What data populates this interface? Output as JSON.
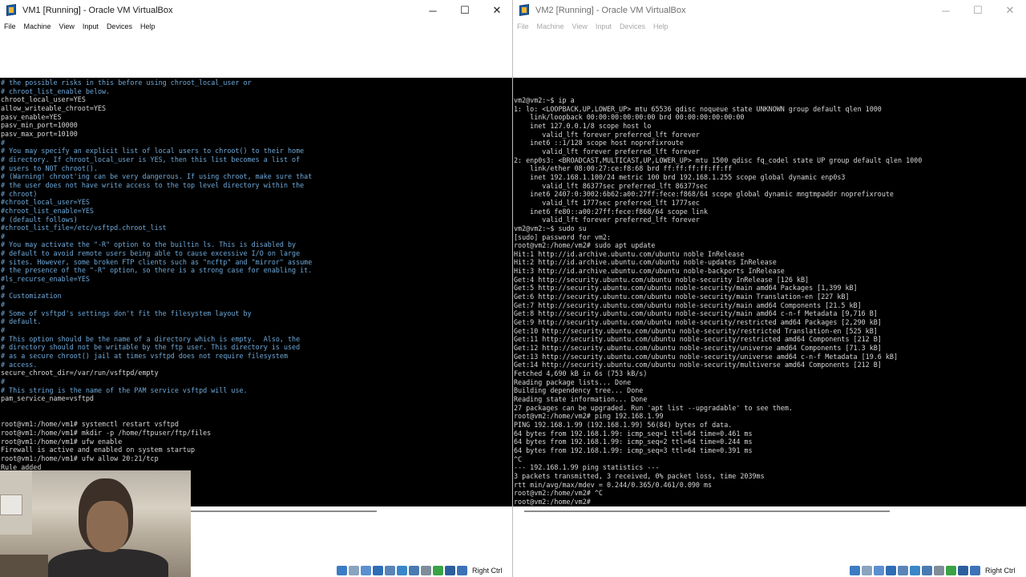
{
  "vm1": {
    "title": "VM1 [Running] - Oracle VM VirtualBox",
    "menu": [
      "File",
      "Machine",
      "View",
      "Input",
      "Devices",
      "Help"
    ],
    "terminal_lines": [
      "# the possible risks in this before using chroot_local_user or",
      "# chroot_list_enable below.",
      "chroot_local_user=YES",
      "allow_writeable_chroot=YES",
      "pasv_enable=YES",
      "pasv_min_port=10000",
      "pasv_max_port=10100",
      "#",
      "# You may specify an explicit list of local users to chroot() to their home",
      "# directory. If chroot_local_user is YES, then this list becomes a list of",
      "# users to NOT chroot().",
      "# (Warning! chroot'ing can be very dangerous. If using chroot, make sure that",
      "# the user does not have write access to the top level directory within the",
      "# chroot)",
      "#chroot_local_user=YES",
      "#chroot_list_enable=YES",
      "# (default follows)",
      "#chroot_list_file=/etc/vsftpd.chroot_list",
      "#",
      "# You may activate the \"-R\" option to the builtin ls. This is disabled by",
      "# default to avoid remote users being able to cause excessive I/O on large",
      "# sites. However, some broken FTP clients such as \"ncftp\" and \"mirror\" assume",
      "# the presence of the \"-R\" option, so there is a strong case for enabling it.",
      "#ls_recurse_enable=YES",
      "#",
      "# Customization",
      "#",
      "# Some of vsftpd's settings don't fit the filesystem layout by",
      "# default.",
      "#",
      "# This option should be the name of a directory which is empty.  Also, the",
      "# directory should not be writable by the ftp user. This directory is used",
      "# as a secure chroot() jail at times vsftpd does not require filesystem",
      "# access.",
      "secure_chroot_dir=/var/run/vsftpd/empty",
      "#",
      "# This string is the name of the PAM service vsftpd will use.",
      "pam_service_name=vsftpd",
      "",
      "",
      "root@vm1:/home/vm1# systemctl restart vsftpd",
      "root@vm1:/home/vm1# mkdir -p /home/ftpuser/ftp/files",
      "root@vm1:/home/vm1# ufw enable",
      "Firewall is active and enabled on system startup",
      "root@vm1:/home/vm1# ufw allow 20:21/tcp",
      "Rule added"
    ],
    "host_key": "Right Ctrl"
  },
  "vm2": {
    "title": "VM2 [Running] - Oracle VM VirtualBox",
    "menu": [
      "File",
      "Machine",
      "View",
      "Input",
      "Devices",
      "Help"
    ],
    "terminal_lines": [
      "vm2@vm2:~$ ip a",
      "1: lo: <LOOPBACK,UP,LOWER_UP> mtu 65536 qdisc noqueue state UNKNOWN group default qlen 1000",
      "    link/loopback 00:00:00:00:00:00 brd 00:00:00:00:00:00",
      "    inet 127.0.0.1/8 scope host lo",
      "       valid_lft forever preferred_lft forever",
      "    inet6 ::1/128 scope host noprefixroute",
      "       valid_lft forever preferred_lft forever",
      "2: enp0s3: <BROADCAST,MULTICAST,UP,LOWER_UP> mtu 1500 qdisc fq_codel state UP group default qlen 1000",
      "    link/ether 08:00:27:ce:f8:68 brd ff:ff:ff:ff:ff:ff",
      "    inet 192.168.1.100/24 metric 100 brd 192.168.1.255 scope global dynamic enp0s3",
      "       valid_lft 86377sec preferred_lft 86377sec",
      "    inet6 2407:0:3002:6b62:a00:27ff:fece:f868/64 scope global dynamic mngtmpaddr noprefixroute",
      "       valid_lft 1777sec preferred_lft 1777sec",
      "    inet6 fe80::a00:27ff:fece:f868/64 scope link",
      "       valid_lft forever preferred_lft forever",
      "vm2@vm2:~$ sudo su",
      "[sudo] password for vm2:",
      "root@vm2:/home/vm2# sudo apt update",
      "Hit:1 http://id.archive.ubuntu.com/ubuntu noble InRelease",
      "Hit:2 http://id.archive.ubuntu.com/ubuntu noble-updates InRelease",
      "Hit:3 http://id.archive.ubuntu.com/ubuntu noble-backports InRelease",
      "Get:4 http://security.ubuntu.com/ubuntu noble-security InRelease [126 kB]",
      "Get:5 http://security.ubuntu.com/ubuntu noble-security/main amd64 Packages [1,399 kB]",
      "Get:6 http://security.ubuntu.com/ubuntu noble-security/main Translation-en [227 kB]",
      "Get:7 http://security.ubuntu.com/ubuntu noble-security/main amd64 Components [21.5 kB]",
      "Get:8 http://security.ubuntu.com/ubuntu noble-security/main amd64 c-n-f Metadata [9,716 B]",
      "Get:9 http://security.ubuntu.com/ubuntu noble-security/restricted amd64 Packages [2,290 kB]",
      "Get:10 http://security.ubuntu.com/ubuntu noble-security/restricted Translation-en [525 kB]",
      "Get:11 http://security.ubuntu.com/ubuntu noble-security/restricted amd64 Components [212 B]",
      "Get:12 http://security.ubuntu.com/ubuntu noble-security/universe amd64 Components [71.3 kB]",
      "Get:13 http://security.ubuntu.com/ubuntu noble-security/universe amd64 c-n-f Metadata [19.6 kB]",
      "Get:14 http://security.ubuntu.com/ubuntu noble-security/multiverse amd64 Components [212 B]",
      "Fetched 4,690 kB in 6s (753 kB/s)",
      "Reading package lists... Done",
      "Building dependency tree... Done",
      "Reading state information... Done",
      "27 packages can be upgraded. Run 'apt list --upgradable' to see them.",
      "root@vm2:/home/vm2# ping 192.168.1.99",
      "PING 192.168.1.99 (192.168.1.99) 56(84) bytes of data.",
      "64 bytes from 192.168.1.99: icmp_seq=1 ttl=64 time=0.461 ms",
      "64 bytes from 192.168.1.99: icmp_seq=2 ttl=64 time=0.244 ms",
      "64 bytes from 192.168.1.99: icmp_seq=3 ttl=64 time=0.391 ms",
      "^C",
      "--- 192.168.1.99 ping statistics ---",
      "3 packets transmitted, 3 received, 0% packet loss, time 2039ms",
      "rtt min/avg/max/mdev = 0.244/0.365/0.461/0.090 ms",
      "root@vm2:/home/vm2# ^C",
      "root@vm2:/home/vm2# "
    ],
    "host_key": "Right Ctrl"
  },
  "window_controls": {
    "minimize": "─",
    "maximize": "☐",
    "close": "✕"
  },
  "status_icons": [
    "hard-disk-icon",
    "optical-drive-icon",
    "audio-icon",
    "network-icon",
    "usb-icon",
    "shared-folders-icon",
    "display-icon",
    "recording-icon",
    "cpu-icon",
    "mouse-integration-icon",
    "keyboard-icon"
  ],
  "colors": {
    "terminal_bg": "#000000",
    "terminal_fg": "#d7d7d7",
    "comment": "#6ea8d8"
  }
}
